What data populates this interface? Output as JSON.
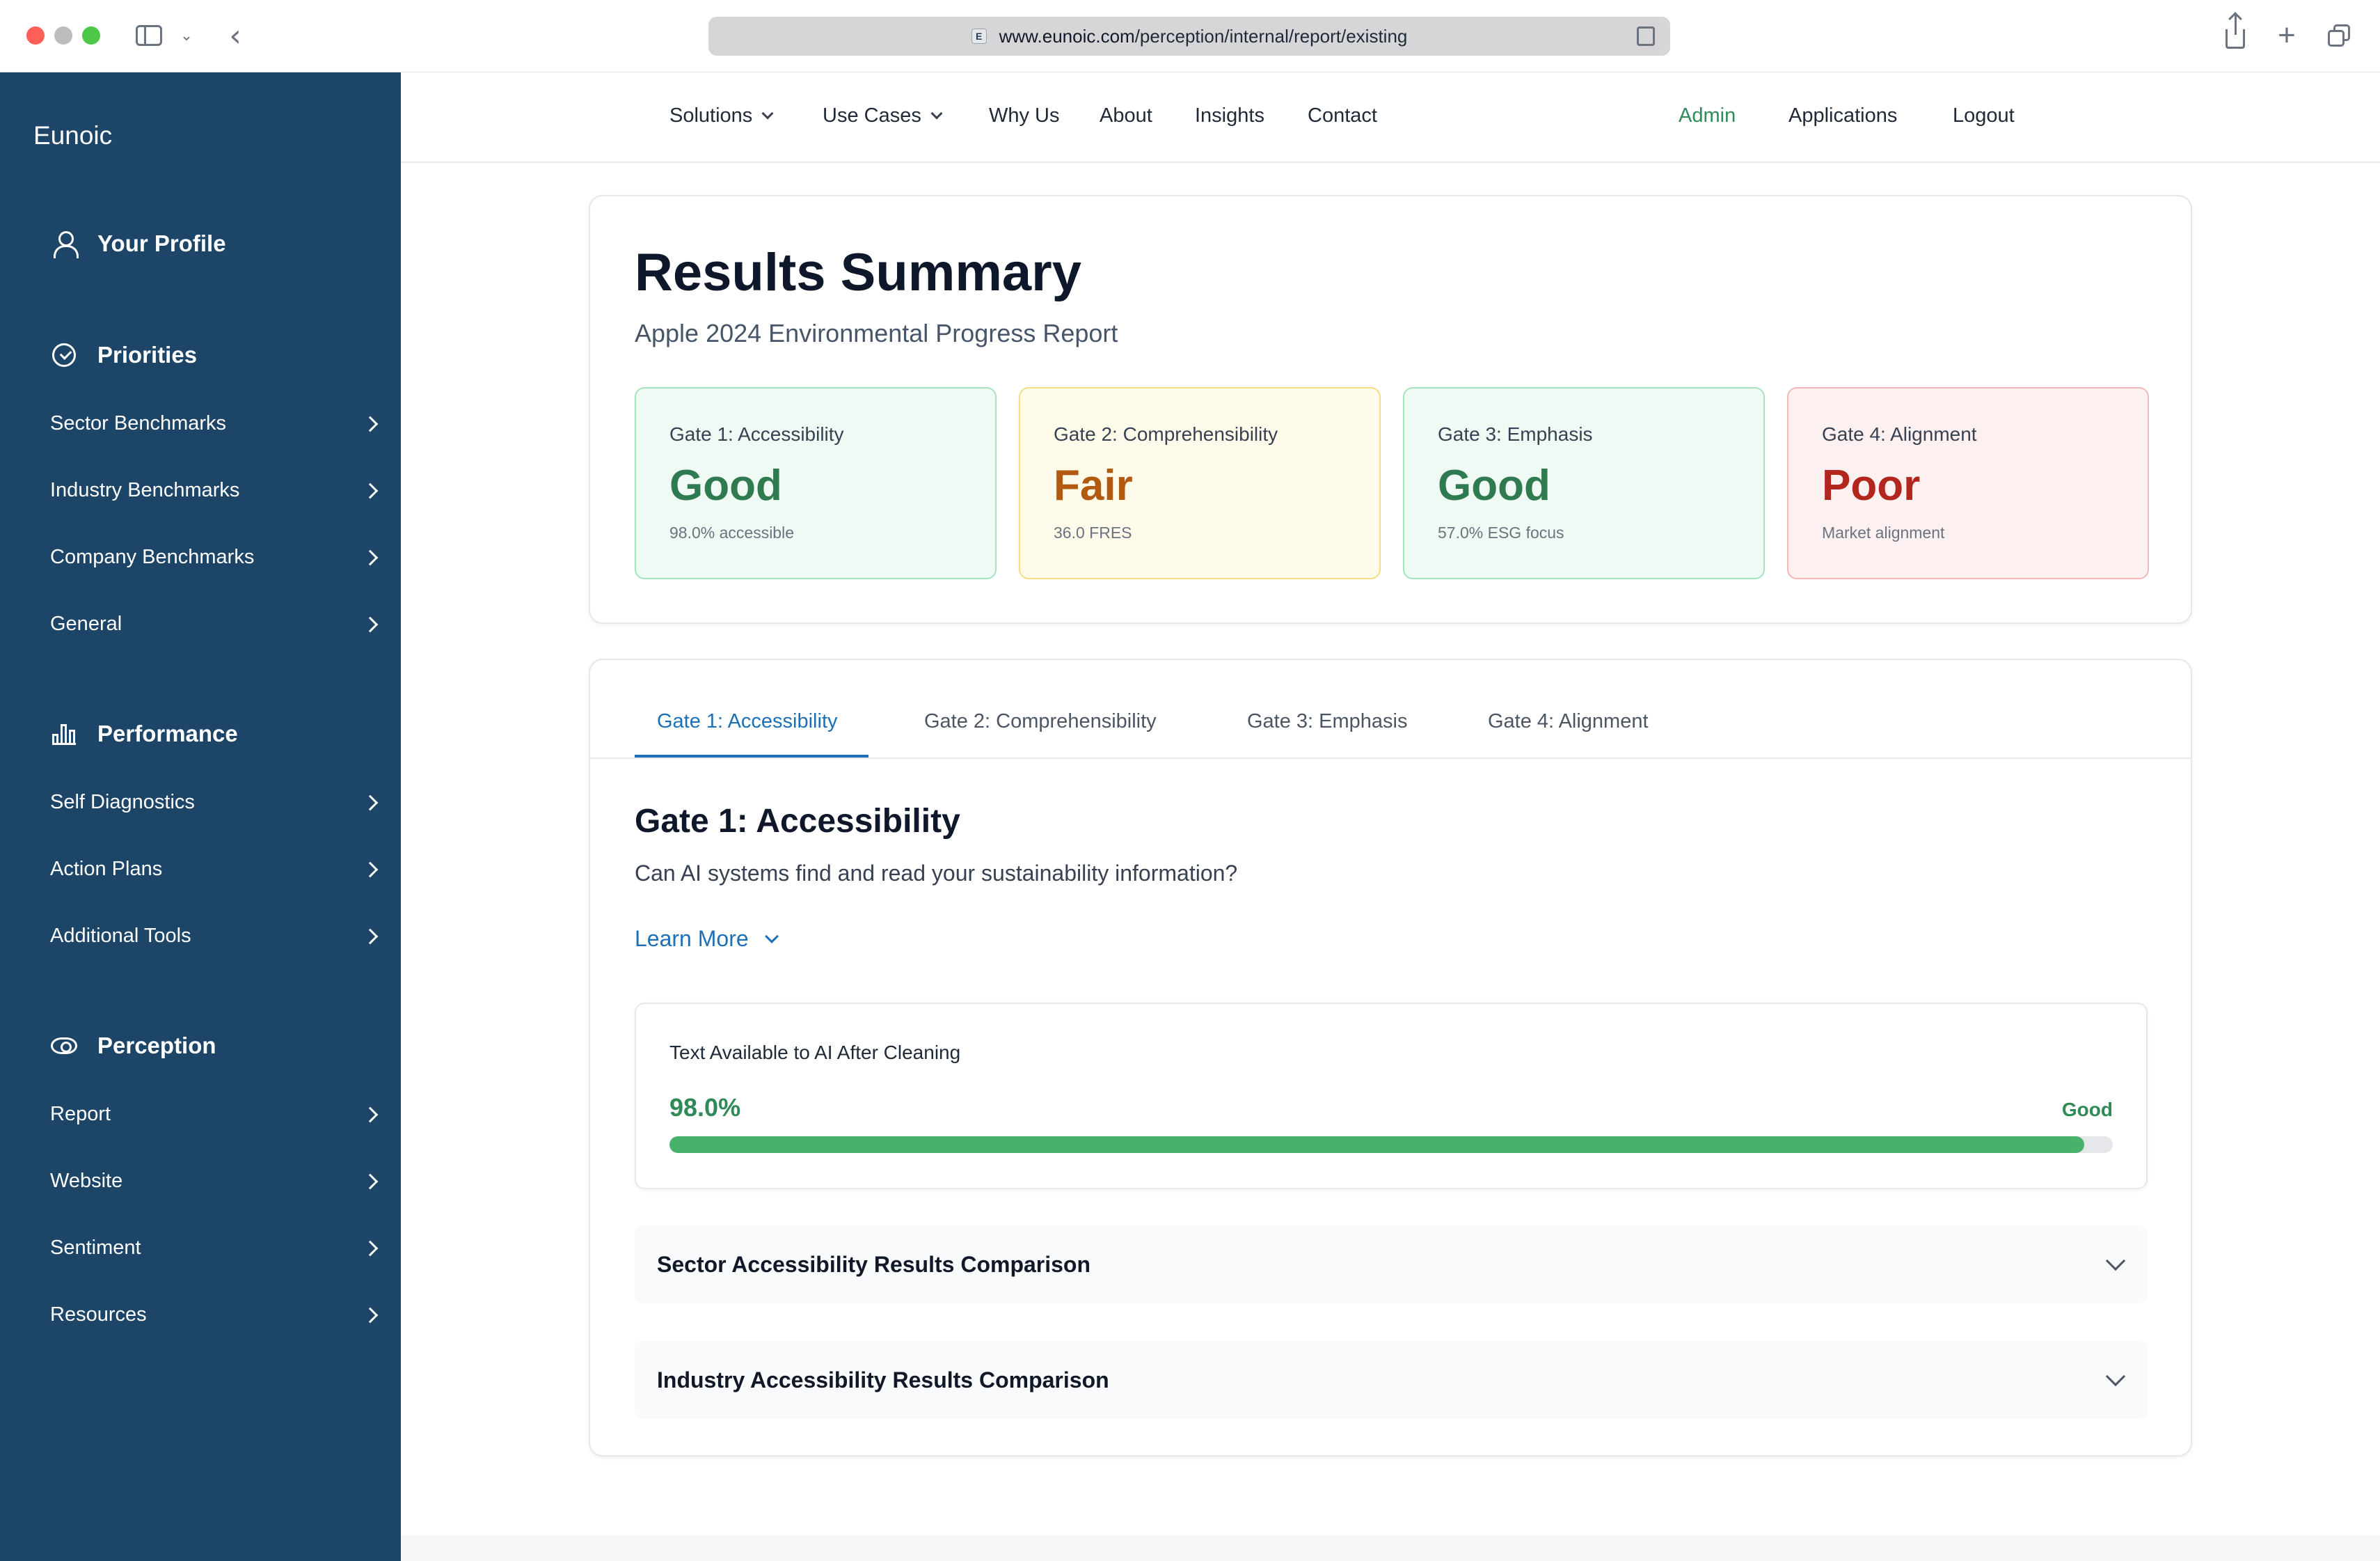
{
  "browser": {
    "url_domain": "www.eunoic.com",
    "url_path": "/perception/internal/report/existing",
    "favicon_letter": "E"
  },
  "sidebar": {
    "brand": "Eunoic",
    "profile_label": "Your Profile",
    "sections": [
      {
        "title": "Priorities",
        "icon": "check-circle-icon",
        "items": [
          "Sector Benchmarks",
          "Industry Benchmarks",
          "Company Benchmarks",
          "General"
        ]
      },
      {
        "title": "Performance",
        "icon": "bar-chart-icon",
        "items": [
          "Self Diagnostics",
          "Action Plans",
          "Additional Tools"
        ]
      },
      {
        "title": "Perception",
        "icon": "eye-icon",
        "items": [
          "Report",
          "Website",
          "Sentiment",
          "Resources"
        ]
      }
    ]
  },
  "topnav": {
    "links": [
      "Solutions",
      "Use Cases",
      "Why Us",
      "About",
      "Insights",
      "Contact"
    ],
    "right_links": [
      "Admin",
      "Applications",
      "Logout"
    ]
  },
  "summary": {
    "title": "Results Summary",
    "subtitle": "Apple 2024 Environmental Progress Report",
    "gates": [
      {
        "label": "Gate 1: Accessibility",
        "rating": "Good",
        "detail": "98.0% accessible",
        "status": "good"
      },
      {
        "label": "Gate 2: Comprehensibility",
        "rating": "Fair",
        "detail": "36.0 FRES",
        "status": "fair"
      },
      {
        "label": "Gate 3: Emphasis",
        "rating": "Good",
        "detail": "57.0% ESG focus",
        "status": "good"
      },
      {
        "label": "Gate 4: Alignment",
        "rating": "Poor",
        "detail": "Market alignment",
        "status": "poor"
      }
    ]
  },
  "colors": {
    "good_text": "#2f7a4e",
    "good_bg": "#eefaf3",
    "good_border": "#a7e3bf",
    "fair_text": "#b25a12",
    "fair_bg": "#fffbea",
    "fair_border": "#f5dc86",
    "poor_text": "#b3261e",
    "poor_bg": "#fdf0f0",
    "poor_border": "#f2b8b8",
    "accent": "#1d70b8",
    "sidebar_bg": "#1c4568"
  },
  "detail": {
    "tabs": [
      "Gate 1: Accessibility",
      "Gate 2: Comprehensibility",
      "Gate 3: Emphasis",
      "Gate 4: Alignment"
    ],
    "active_tab": 0,
    "section_title": "Gate 1: Accessibility",
    "section_question": "Can AI systems find and read your sustainability information?",
    "learn_more": "Learn More",
    "metric": {
      "label": "Text Available to AI After Cleaning",
      "value_text": "98.0%",
      "status": "Good",
      "progress_fraction": 0.98
    },
    "accordions": [
      "Sector Accessibility Results Comparison",
      "Industry Accessibility Results Comparison"
    ]
  }
}
